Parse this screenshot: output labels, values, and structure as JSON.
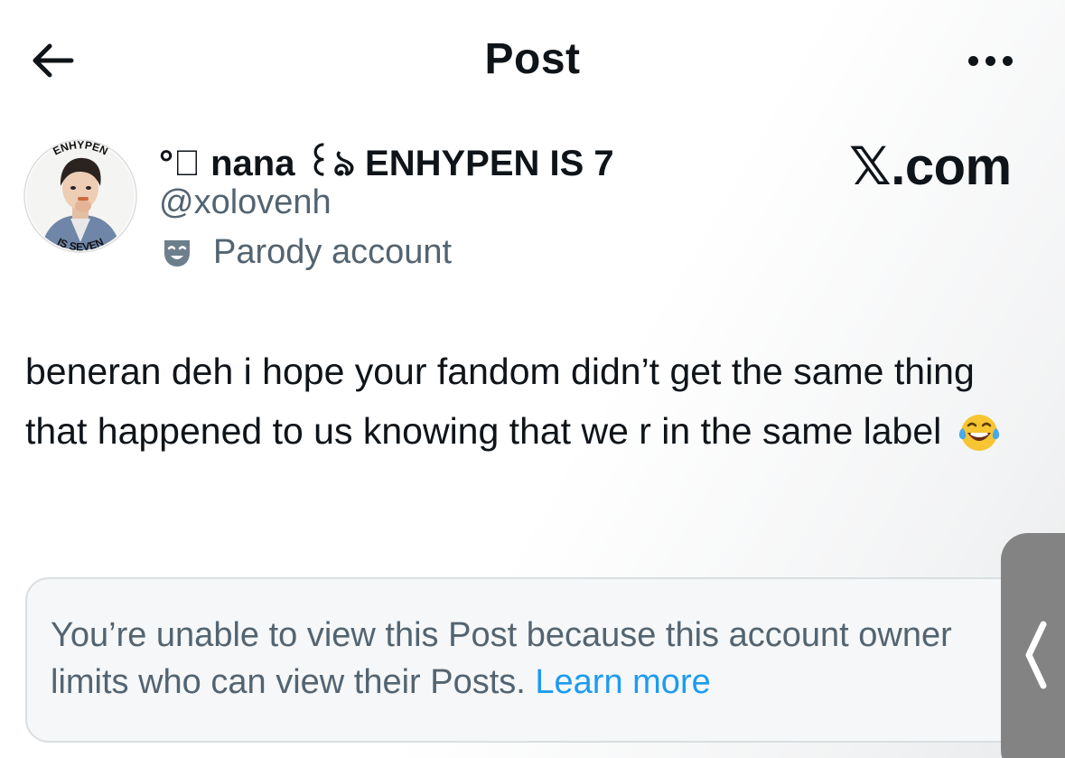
{
  "header": {
    "title": "Post"
  },
  "author": {
    "display_name": "°ৣ nana ꒰ঌ ENHYPEN IS 7",
    "handle": "@xolovenh",
    "parody_label": "Parody account",
    "avatar_text_top": "ENHYPEN",
    "avatar_text_bottom": "IS SEVEN"
  },
  "watermark": "𝕏.com",
  "post": {
    "text": "beneran deh i hope your fandom didn’t get the same thing that happened to us knowing that we r in the same label",
    "emoji": "face-with-tears-of-joy"
  },
  "notice": {
    "text": "You’re unable to view this Post because this account owner limits who can view their Posts.",
    "link_label": "Learn more"
  },
  "icons": {
    "back": "back-arrow-icon",
    "more": "more-horizontal-icon",
    "parody": "theater-mask-icon",
    "side_handle": "chevron-left-icon"
  },
  "colors": {
    "text_primary": "#0f1419",
    "text_secondary": "#536471",
    "link": "#1d9bf0",
    "notice_bg": "#f5f7f8",
    "side_handle": "#838383"
  }
}
